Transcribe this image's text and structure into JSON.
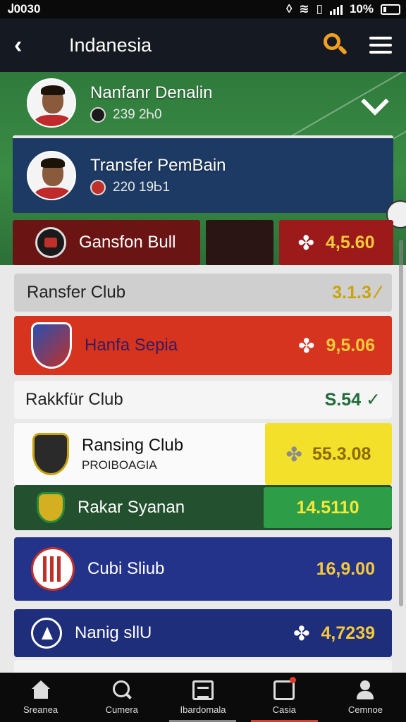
{
  "status_bar": {
    "time": "Ꭻ0030",
    "battery": "10%"
  },
  "header": {
    "title": "Indanesia"
  },
  "players": [
    {
      "name": "Nanfanr Denalin",
      "meta": "239 2Ꮒ0"
    },
    {
      "name": "Transfer PemBain",
      "meta": "220 19Ꮟ1"
    }
  ],
  "transfer_row": {
    "name": "Gansfon Bull",
    "price": "4,5.60"
  },
  "list": [
    {
      "name": "Ransfer Club",
      "price": "3.1.3 ⁄"
    },
    {
      "name": "Hanfa Sepia",
      "price": "9,5.06"
    },
    {
      "name": "Rakkfür Club",
      "price": "S.54 ✓"
    },
    {
      "name": "Ransing Club",
      "sub": "PROIBOAGIA",
      "price": "55.3.08"
    },
    {
      "name": "Rakar Syanan",
      "price": "14.5110"
    },
    {
      "name": "Cubi Sliub",
      "price": "16,9.00"
    },
    {
      "name": "Nanig sllU",
      "price": "4,7239"
    }
  ],
  "nav": [
    {
      "label": "Sreanea",
      "icon": "home-icon"
    },
    {
      "label": "Cumera",
      "icon": "search-icon"
    },
    {
      "label": "Ibardomala",
      "icon": "newspaper-icon"
    },
    {
      "label": "Casia",
      "icon": "message-icon"
    },
    {
      "label": "Cemnoe",
      "icon": "user-icon"
    }
  ],
  "colors": {
    "accent": "#f0a020",
    "price": "#f6c93a",
    "danger": "#d6341f",
    "navy": "#24338a"
  }
}
